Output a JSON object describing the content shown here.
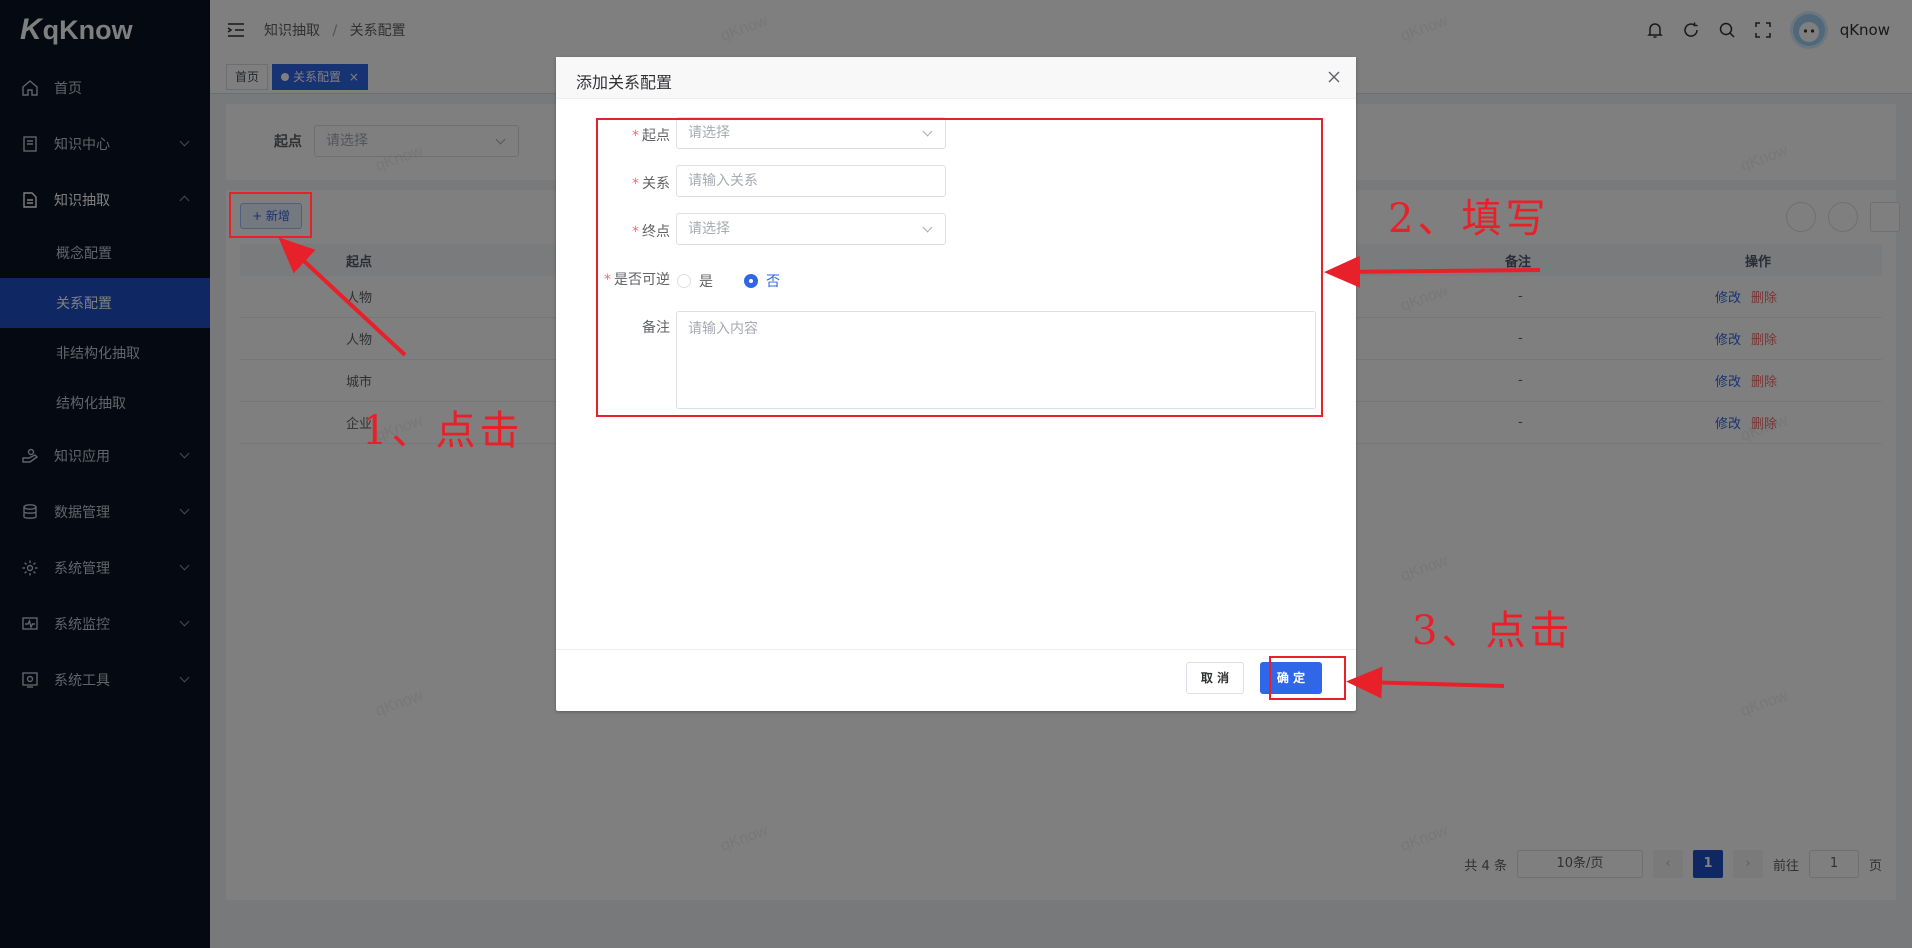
{
  "app": {
    "logo_text": "qKnow",
    "logo_mark": "K",
    "watermark": "qKnow"
  },
  "sidebar": {
    "items": [
      {
        "label": "首页",
        "icon": "home-icon"
      },
      {
        "label": "知识中心",
        "icon": "book-icon"
      },
      {
        "label": "知识抽取",
        "icon": "document-icon"
      },
      {
        "label": "知识应用",
        "icon": "hand-icon"
      },
      {
        "label": "数据管理",
        "icon": "database-icon"
      },
      {
        "label": "系统管理",
        "icon": "gear-icon"
      },
      {
        "label": "系统监控",
        "icon": "monitor-icon"
      },
      {
        "label": "系统工具",
        "icon": "tools-icon"
      }
    ],
    "sub_items": [
      {
        "label": "概念配置"
      },
      {
        "label": "关系配置"
      },
      {
        "label": "非结构化抽取"
      },
      {
        "label": "结构化抽取"
      }
    ]
  },
  "header": {
    "breadcrumb": [
      "知识抽取",
      "关系配置"
    ],
    "breadcrumb_sep": "/",
    "username": "qKnow"
  },
  "tags": {
    "home": "首页",
    "current": "关系配置",
    "close": "×"
  },
  "query": {
    "start_label": "起点",
    "start_placeholder": "请选择"
  },
  "toolbar": {
    "add_label": "+ 新增"
  },
  "table": {
    "headers": {
      "start": "起点",
      "remark": "备注",
      "actions": "操作"
    },
    "rows": [
      {
        "start": "人物",
        "remark": "-"
      },
      {
        "start": "人物",
        "remark": "-"
      },
      {
        "start": "城市",
        "remark": "-"
      },
      {
        "start": "企业",
        "remark": "-"
      }
    ],
    "edit_label": "修改",
    "delete_label": "删除"
  },
  "pagination": {
    "total": "共 4 条",
    "page_size": "10条/页",
    "current_page": "1",
    "goto_label": "前往",
    "goto_value": "1",
    "page_suffix": "页"
  },
  "dialog": {
    "title": "添加关系配置",
    "fields": {
      "start": {
        "label": "起点",
        "placeholder": "请选择"
      },
      "relation": {
        "label": "关系",
        "placeholder": "请输入关系"
      },
      "end": {
        "label": "终点",
        "placeholder": "请选择"
      },
      "reversible": {
        "label": "是否可逆",
        "options": [
          "是",
          "否"
        ],
        "selected": "否"
      },
      "remark": {
        "label": "备注",
        "placeholder": "请输入内容"
      }
    },
    "required_mark": "*",
    "cancel_label": "取 消",
    "ok_label": "确 定"
  },
  "annotations": {
    "step1": "1、点击",
    "step2": "2、填写",
    "step3": "3、点击",
    "color": "#e8202a"
  },
  "colors": {
    "primary": "#2f67e8",
    "sidebar_bg": "#0a1222",
    "active_menu": "#1f4fc6",
    "danger": "#f56c6c"
  }
}
